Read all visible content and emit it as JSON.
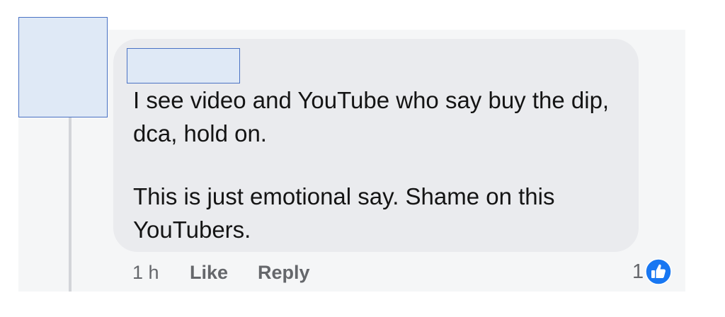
{
  "comment": {
    "paragraphs": [
      "I see video and YouTube who say buy the dip, dca, hold on.",
      "This is just emotional say. Shame on this YouTubers."
    ]
  },
  "actions": {
    "time": "1 h",
    "like_label": "Like",
    "reply_label": "Reply"
  },
  "reactions": {
    "count": "1",
    "icon": "thumbs-up-icon",
    "color": "#1877f2"
  }
}
